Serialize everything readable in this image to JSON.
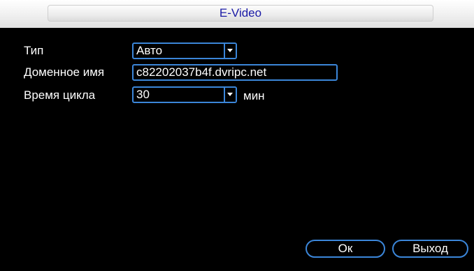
{
  "window": {
    "title": "E-Video"
  },
  "form": {
    "type_label": "Тип",
    "type_value": "Авто",
    "domain_label": "Доменное имя",
    "domain_value": "c82202037b4f.dvripc.net",
    "cycle_label": "Время цикла",
    "cycle_value": "30",
    "cycle_unit": "мин"
  },
  "buttons": {
    "ok_label": "Ок",
    "exit_label": "Выход"
  },
  "colors": {
    "accent": "#3b86d9",
    "title_text": "#1a1aa6",
    "background": "#000000"
  }
}
